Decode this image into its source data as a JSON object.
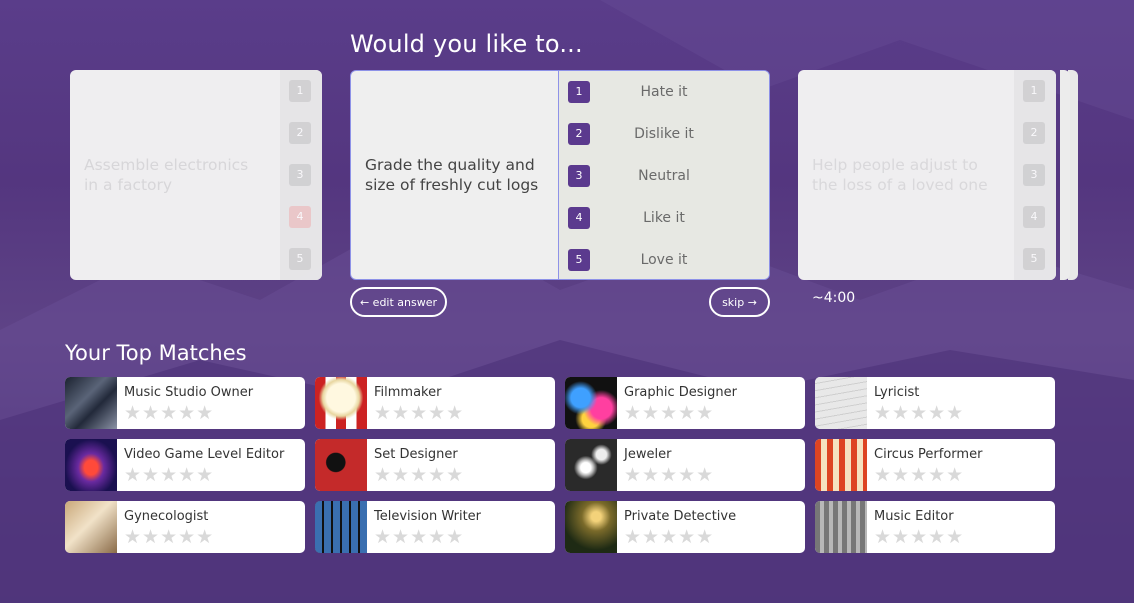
{
  "question": {
    "title": "Would you like to..."
  },
  "cards": {
    "left": {
      "text": "Assemble electronics in a factory",
      "scale": [
        "1",
        "2",
        "3",
        "4",
        "5"
      ]
    },
    "main": {
      "text": "Grade the quality and size of freshly cut logs",
      "options": [
        {
          "num": "1",
          "label": "Hate it"
        },
        {
          "num": "2",
          "label": "Dislike it"
        },
        {
          "num": "3",
          "label": "Neutral"
        },
        {
          "num": "4",
          "label": "Like it"
        },
        {
          "num": "5",
          "label": "Love it"
        }
      ]
    },
    "right": {
      "text": "Help people adjust to the loss of a loved one",
      "scale": [
        "1",
        "2",
        "3",
        "4",
        "5"
      ]
    }
  },
  "controls": {
    "edit_answer": "← edit answer",
    "skip": "skip →",
    "timer": "~4:00"
  },
  "matches": {
    "title": "Your Top Matches",
    "stars": "★★★★★",
    "items": [
      {
        "name": "Music Studio Owner"
      },
      {
        "name": "Filmmaker"
      },
      {
        "name": "Graphic Designer"
      },
      {
        "name": "Lyricist"
      },
      {
        "name": "Video Game Level Editor"
      },
      {
        "name": "Set Designer"
      },
      {
        "name": "Jeweler"
      },
      {
        "name": "Circus Performer"
      },
      {
        "name": "Gynecologist"
      },
      {
        "name": "Television Writer"
      },
      {
        "name": "Private Detective"
      },
      {
        "name": "Music Editor"
      }
    ]
  },
  "colors": {
    "accent": "#5b3a8e",
    "selected_border": "#8e92e8",
    "background": "#54367f"
  }
}
